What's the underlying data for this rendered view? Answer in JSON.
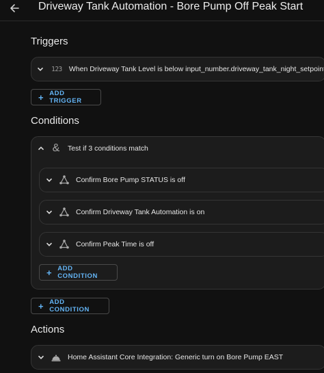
{
  "header": {
    "title": "Driveway Tank Automation - Bore Pump Off Peak Start",
    "back_icon": "arrow-left-icon"
  },
  "triggers": {
    "section_title": "Triggers",
    "items": [
      {
        "label": "When Driveway Tank Level is below input_number.driveway_tank_night_setpoint",
        "icon": "numeric-icon",
        "icon_text": "123"
      }
    ],
    "add_button": "ADD TRIGGER"
  },
  "conditions": {
    "section_title": "Conditions",
    "group": {
      "label": "Test if 3 conditions match",
      "icon": "ampersand-icon",
      "icon_text": "&",
      "items": [
        {
          "label": "Confirm Bore Pump STATUS is off",
          "icon": "state-graph-icon"
        },
        {
          "label": "Confirm Driveway Tank Automation is on",
          "icon": "state-graph-icon"
        },
        {
          "label": "Confirm Peak Time is off",
          "icon": "state-graph-icon"
        }
      ],
      "add_button": "ADD CONDITION"
    },
    "add_button": "ADD CONDITION"
  },
  "actions": {
    "section_title": "Actions",
    "items": [
      {
        "label": "Home Assistant Core Integration: Generic turn on Bore Pump EAST",
        "icon": "service-bell-icon"
      }
    ]
  },
  "colors": {
    "background": "#111111",
    "card": "#1c1c1c",
    "border": "#353535",
    "accent": "#64b5f6",
    "text": "#e6e6e6"
  }
}
